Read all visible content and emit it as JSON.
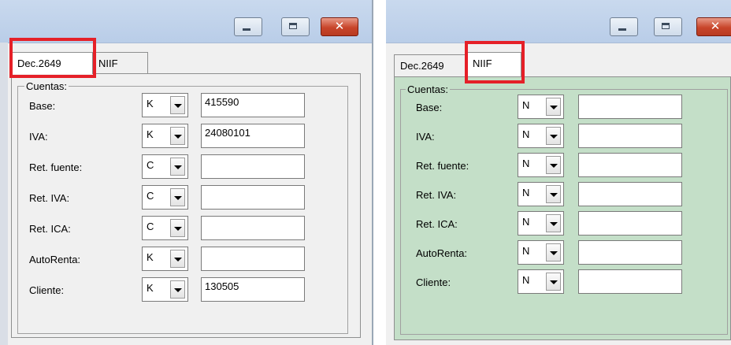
{
  "colors": {
    "niif_body": "#c4dfc8",
    "highlight": "#e52028"
  },
  "windows": [
    {
      "id": "left",
      "title_controls": {
        "minimize": "minimize-icon",
        "maximize": "maximize-icon",
        "close": "✕"
      },
      "tabs": [
        {
          "label": "Dec.2649",
          "active": true
        },
        {
          "label": "NIIF",
          "active": false
        }
      ],
      "group_title": "Cuentas:",
      "rows": [
        {
          "label": "Base:",
          "type": "K",
          "value": "415590"
        },
        {
          "label": "IVA:",
          "type": "K",
          "value": "24080101"
        },
        {
          "label": "Ret. fuente:",
          "type": "C",
          "value": ""
        },
        {
          "label": "Ret. IVA:",
          "type": "C",
          "value": ""
        },
        {
          "label": "Ret. ICA:",
          "type": "C",
          "value": ""
        },
        {
          "label": "AutoRenta:",
          "type": "K",
          "value": ""
        },
        {
          "label": "Cliente:",
          "type": "K",
          "value": "130505"
        }
      ]
    },
    {
      "id": "right",
      "title_controls": {
        "minimize": "minimize-icon",
        "maximize": "maximize-icon",
        "close": "✕"
      },
      "tabs": [
        {
          "label": "Dec.2649",
          "active": false
        },
        {
          "label": "NIIF",
          "active": true
        }
      ],
      "group_title": "Cuentas:",
      "rows": [
        {
          "label": "Base:",
          "type": "N",
          "value": ""
        },
        {
          "label": "IVA:",
          "type": "N",
          "value": ""
        },
        {
          "label": "Ret. fuente:",
          "type": "N",
          "value": ""
        },
        {
          "label": "Ret. IVA:",
          "type": "N",
          "value": ""
        },
        {
          "label": "Ret. ICA:",
          "type": "N",
          "value": ""
        },
        {
          "label": "AutoRenta:",
          "type": "N",
          "value": ""
        },
        {
          "label": "Cliente:",
          "type": "N",
          "value": ""
        }
      ]
    }
  ]
}
